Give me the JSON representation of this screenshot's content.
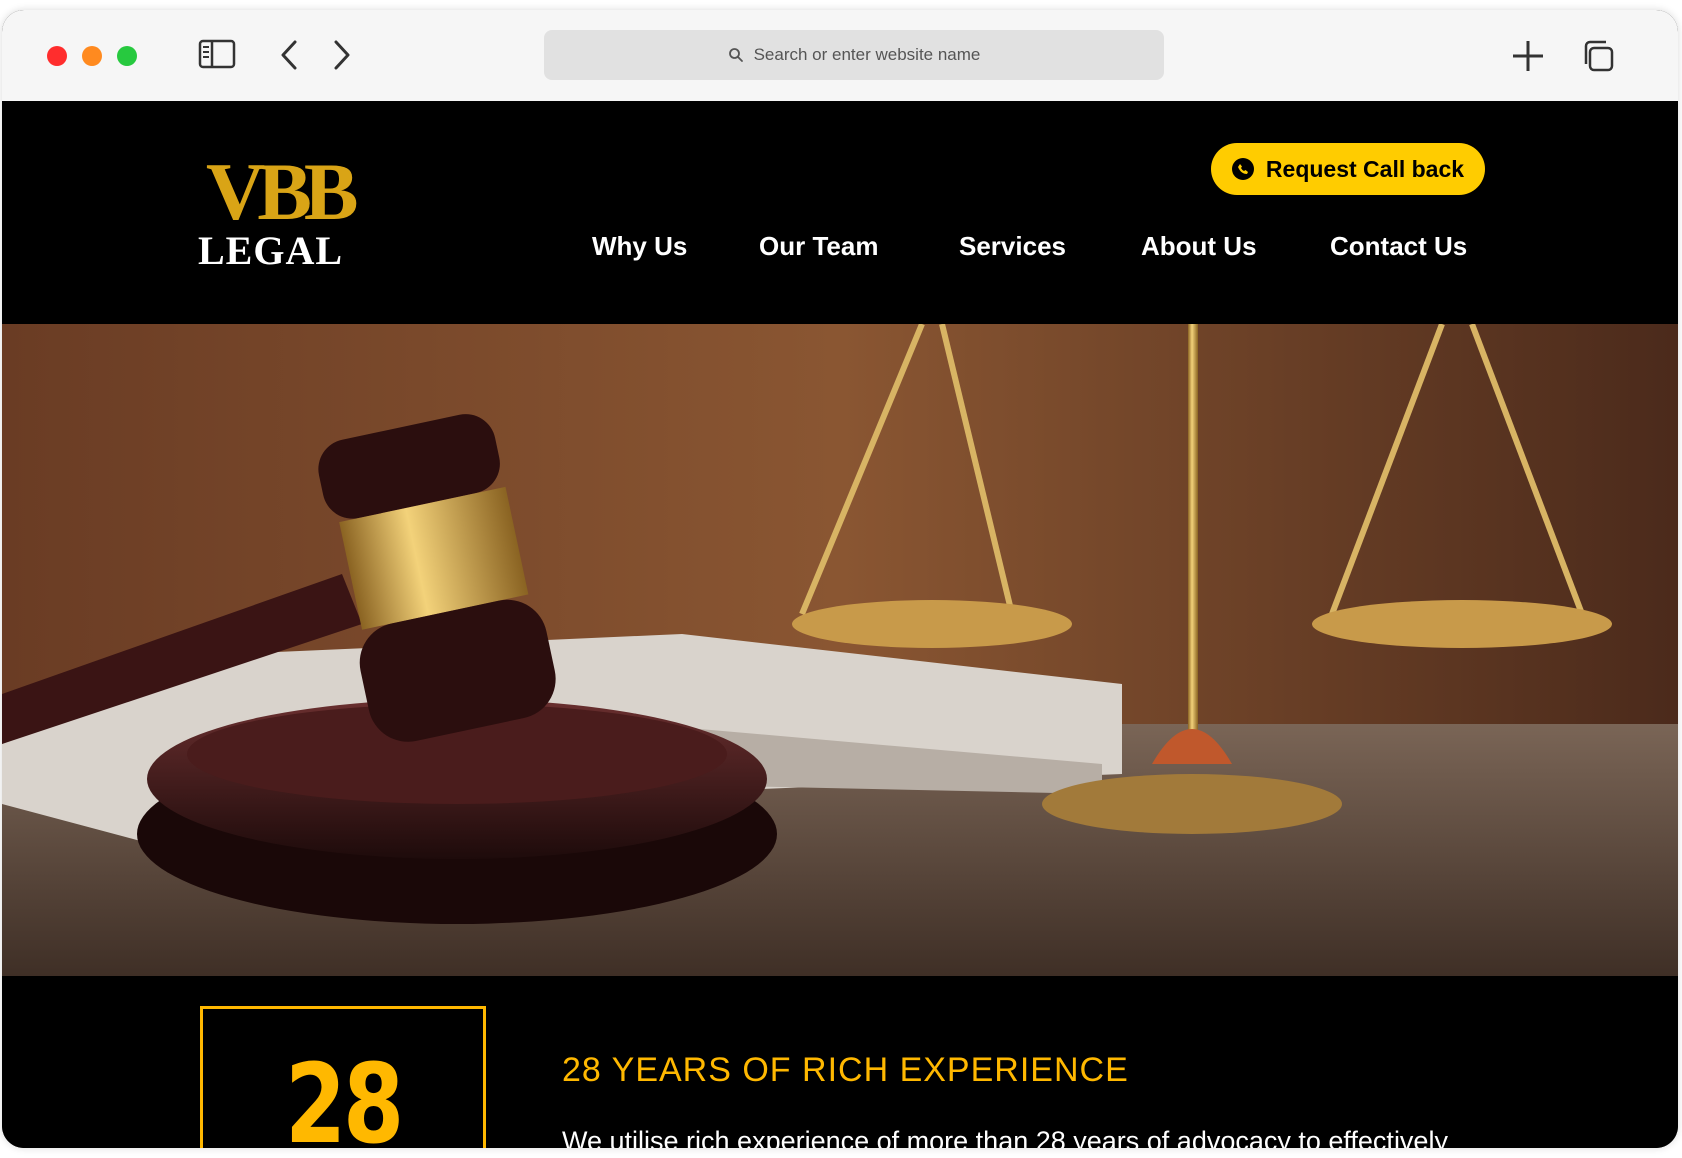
{
  "browser": {
    "address_placeholder": "Search or enter website name",
    "icons": [
      "sidebar-icon",
      "back-icon",
      "forward-icon",
      "search-icon",
      "new-tab-icon",
      "tabs-overview-icon"
    ]
  },
  "site": {
    "logo": {
      "monogram": "VBB",
      "wordmark": "LEGAL"
    },
    "cta_label": "Request Call back",
    "nav": [
      "Why Us",
      "Our Team",
      "Services",
      "About Us",
      "Contact Us"
    ],
    "hero_image": "gavel-and-scales-of-justice",
    "experience": {
      "number": "28",
      "title": "28 YEARS OF RICH EXPERIENCE",
      "text": "We utilise rich experience of more than 28 years of advocacy to effectively"
    }
  },
  "colors": {
    "accent": "#ffcc00",
    "gold": "#ffb800",
    "background": "#000000"
  }
}
